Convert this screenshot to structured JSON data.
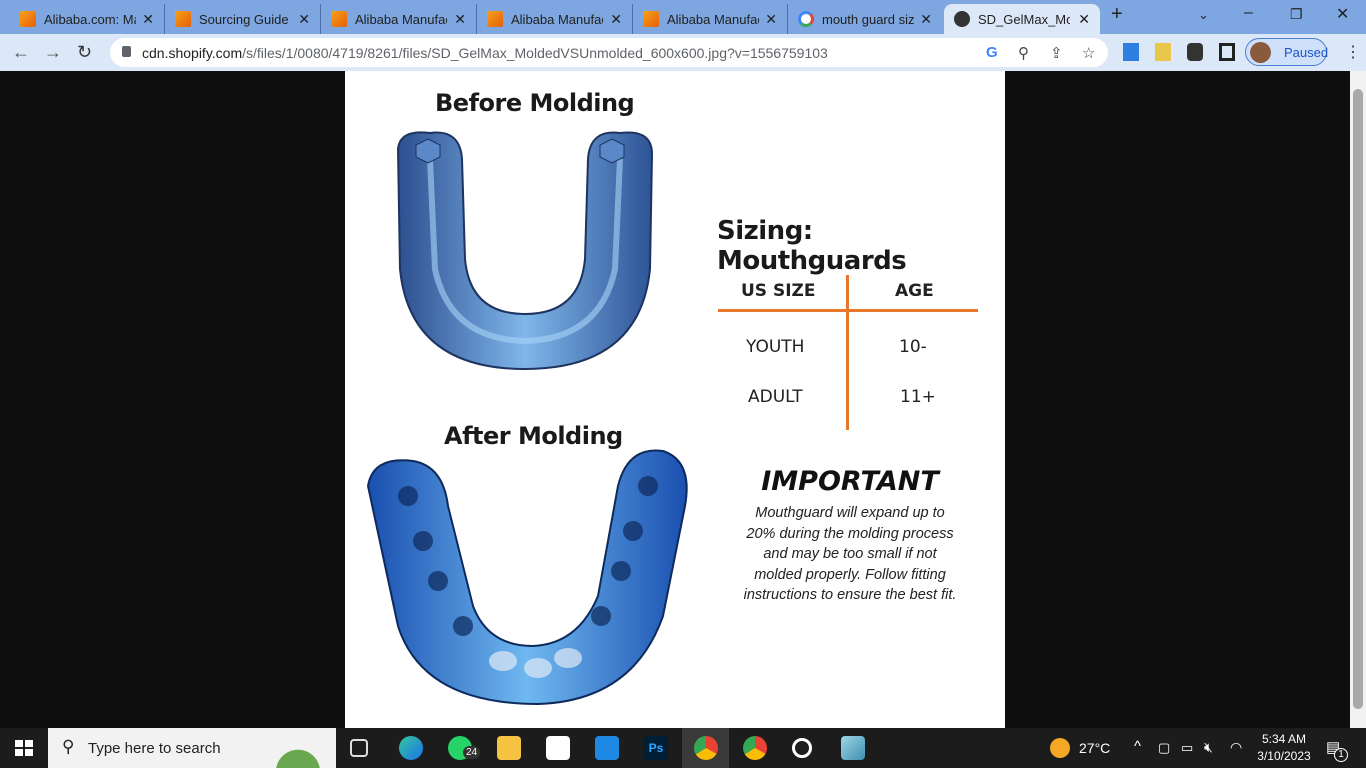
{
  "browser": {
    "tabs": [
      {
        "title": "Alibaba.com: Ma",
        "icon": "alibaba-icon"
      },
      {
        "title": "Sourcing Guide",
        "icon": "alibaba-icon"
      },
      {
        "title": "Alibaba Manufac",
        "icon": "alibaba-icon"
      },
      {
        "title": "Alibaba Manufac",
        "icon": "alibaba-icon"
      },
      {
        "title": "Alibaba Manufac",
        "icon": "alibaba-icon"
      },
      {
        "title": "mouth guard size",
        "icon": "google-icon"
      },
      {
        "title": "SD_GelMax_Mold",
        "icon": "globe-icon",
        "active": true
      }
    ],
    "url_host": "cdn.shopify.com",
    "url_path": "/s/files/1/0080/4719/8261/files/SD_GelMax_MoldedVSUnmolded_600x600.jpg?v=1556759103",
    "profile_status": "Paused"
  },
  "image": {
    "before_title": "Before Molding",
    "after_title": "After Molding",
    "sizing_title": "Sizing: Mouthguards",
    "table": {
      "headers": [
        "US SIZE",
        "AGE"
      ],
      "rows": [
        [
          "YOUTH",
          "10-"
        ],
        [
          "ADULT",
          "11+"
        ]
      ]
    },
    "important_title": "IMPORTANT",
    "important_lines": [
      "Mouthguard will expand up to",
      "20% during the molding process",
      "and may be too small if not",
      "molded properly. Follow fitting",
      "instructions to ensure the best fit."
    ],
    "accent": "#e8772e"
  },
  "taskbar": {
    "search_placeholder": "Type here to search",
    "whatsapp_badge": "24",
    "weather": "27°C",
    "time": "5:34 AM",
    "date": "3/10/2023",
    "notification_count": "1"
  }
}
